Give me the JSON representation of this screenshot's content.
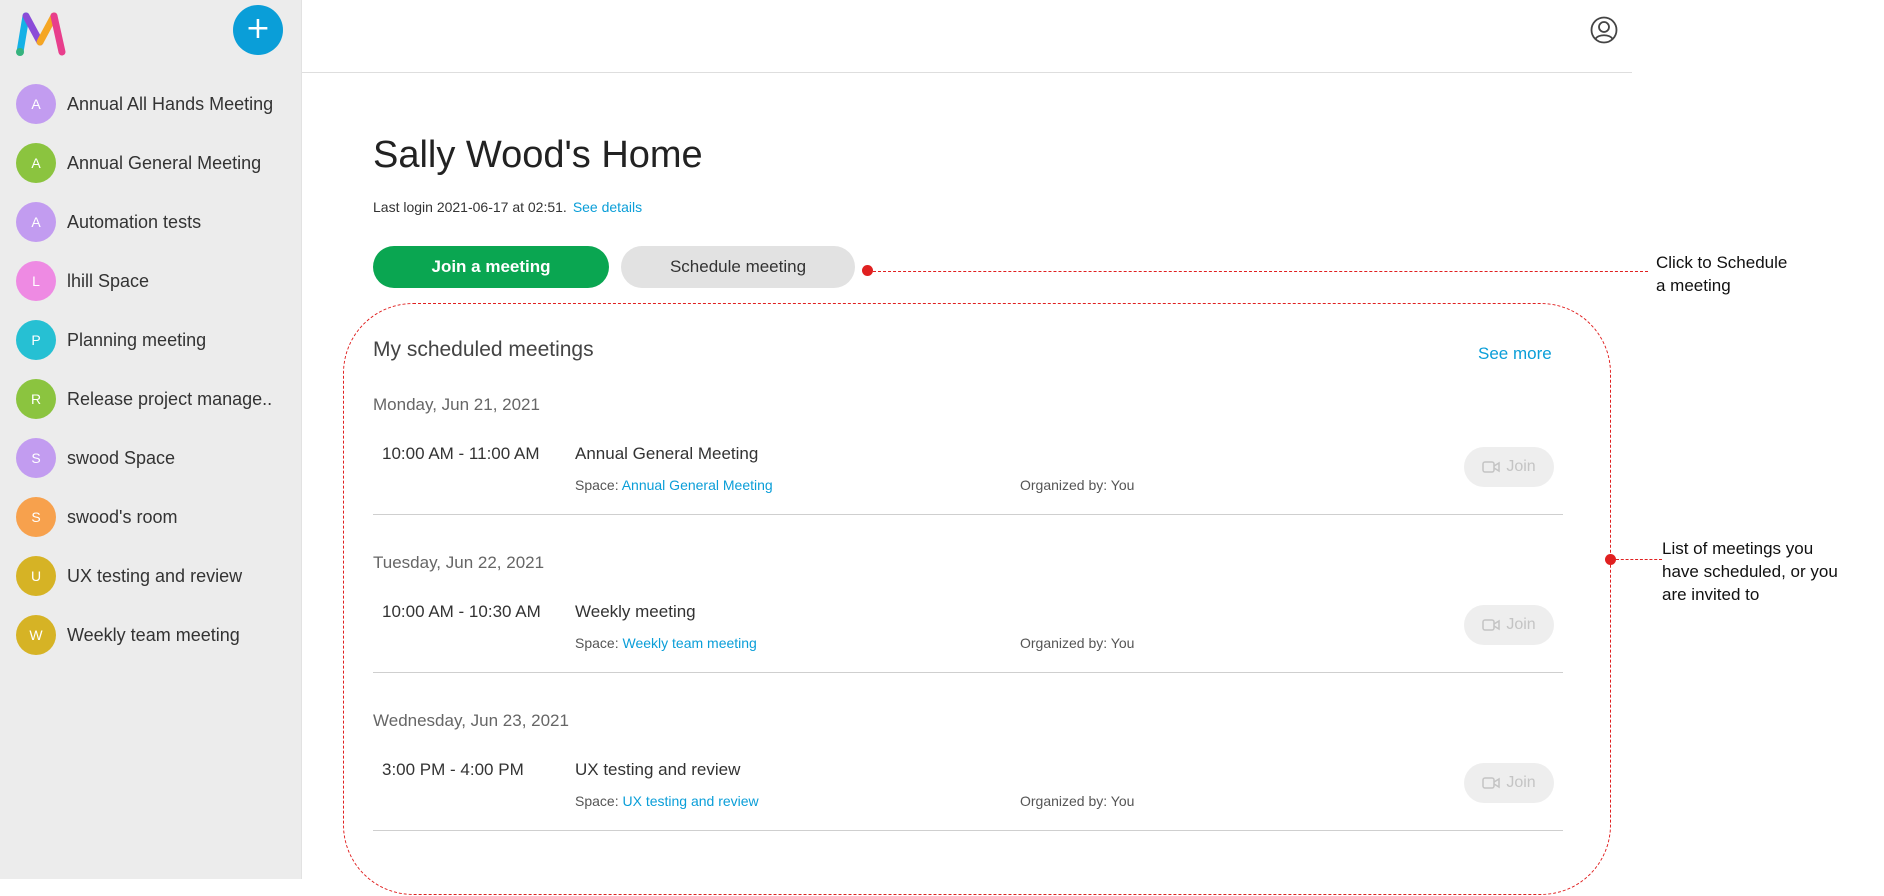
{
  "sidebar": {
    "add_symbol": "+",
    "items": [
      {
        "initial": "A",
        "label": "Annual All Hands Meeting",
        "color": "#c29cf0"
      },
      {
        "initial": "A",
        "label": "Annual General Meeting",
        "color": "#8bc43f"
      },
      {
        "initial": "A",
        "label": "Automation tests",
        "color": "#c29cf0"
      },
      {
        "initial": "L",
        "label": "lhill Space",
        "color": "#ee8ae3"
      },
      {
        "initial": "P",
        "label": "Planning meeting",
        "color": "#26c0d3"
      },
      {
        "initial": "R",
        "label": "Release project manage...",
        "color": "#8bc43f"
      },
      {
        "initial": "S",
        "label": "swood Space",
        "color": "#c29cf0"
      },
      {
        "initial": "S",
        "label": "swood's room",
        "color": "#f7a14d"
      },
      {
        "initial": "U",
        "label": "UX testing and review",
        "color": "#d6b325"
      },
      {
        "initial": "W",
        "label": "Weekly team meeting",
        "color": "#d6b325"
      }
    ]
  },
  "header": {
    "profile_icon": "user-circle-icon"
  },
  "main": {
    "title": "Sally Wood's Home",
    "last_login": "Last login 2021-06-17 at 02:51.",
    "see_details": "See details",
    "join_button": "Join a meeting",
    "schedule_button": "Schedule meeting",
    "section_title": "My scheduled meetings",
    "see_more": "See more",
    "space_prefix": "Space: ",
    "days": [
      {
        "date": "Monday, Jun 21, 2021",
        "time": "10:00 AM - 11:00 AM",
        "title": "Annual General Meeting",
        "space": "Annual General Meeting",
        "organizer": "Organized by: You",
        "join": "Join"
      },
      {
        "date": "Tuesday, Jun 22, 2021",
        "time": "10:00 AM - 10:30 AM",
        "title": "Weekly meeting",
        "space": "Weekly team meeting",
        "organizer": "Organized by: You",
        "join": "Join"
      },
      {
        "date": "Wednesday, Jun 23, 2021",
        "time": "3:00 PM - 4:00 PM",
        "title": "UX testing and review",
        "space": "UX testing and review",
        "organizer": "Organized by: You",
        "join": "Join"
      }
    ]
  },
  "annotations": {
    "schedule_note_line1": "Click to Schedule",
    "schedule_note_line2": "a meeting",
    "list_note_line1": "List of meetings you",
    "list_note_line2": "have scheduled, or you",
    "list_note_line3": "are invited to",
    "color": "#e02020"
  },
  "colors": {
    "accent": "#0a9ed8",
    "join_green": "#0aa651"
  }
}
